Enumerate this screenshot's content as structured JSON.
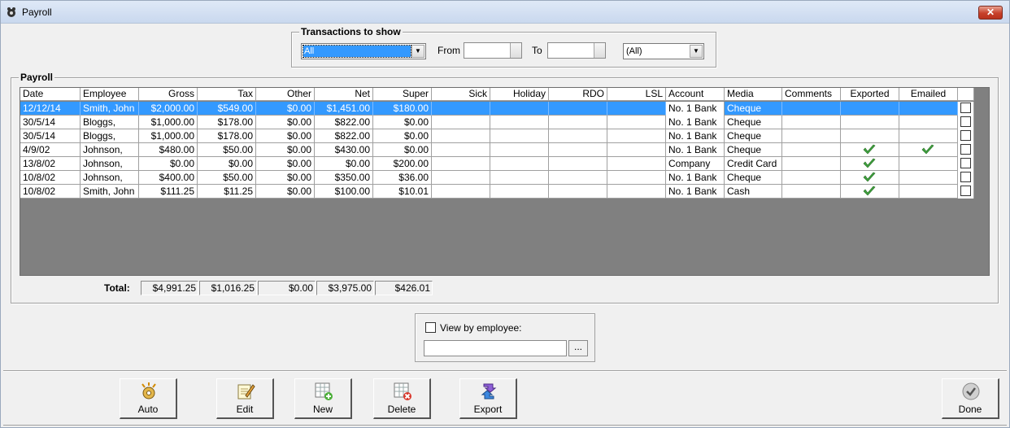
{
  "window": {
    "title": "Payroll",
    "close_glyph": "✕"
  },
  "filter": {
    "legend": "Transactions to show",
    "type_value": "All",
    "from_label": "From",
    "to_label": "To",
    "account_value": "(All)"
  },
  "payroll": {
    "legend": "Payroll",
    "columns": [
      "Date",
      "Employee",
      "Gross",
      "Tax",
      "Other",
      "Net",
      "Super",
      "Sick",
      "Holiday",
      "RDO",
      "LSL",
      "Account",
      "Media",
      "Comments",
      "Exported",
      "Emailed"
    ],
    "rows": [
      {
        "date": "12/12/14",
        "employee": "Smith, John",
        "gross": "$2,000.00",
        "tax": "$549.00",
        "other": "$0.00",
        "net": "$1,451.00",
        "super": "$180.00",
        "account": "No. 1 Bank",
        "media": "Cheque",
        "exported": false,
        "emailed": false,
        "selected": true
      },
      {
        "date": "30/5/14",
        "employee": "Bloggs,",
        "gross": "$1,000.00",
        "tax": "$178.00",
        "other": "$0.00",
        "net": "$822.00",
        "super": "$0.00",
        "account": "No. 1 Bank",
        "media": "Cheque",
        "exported": false,
        "emailed": false,
        "selected": false
      },
      {
        "date": "30/5/14",
        "employee": "Bloggs,",
        "gross": "$1,000.00",
        "tax": "$178.00",
        "other": "$0.00",
        "net": "$822.00",
        "super": "$0.00",
        "account": "No. 1 Bank",
        "media": "Cheque",
        "exported": false,
        "emailed": false,
        "selected": false
      },
      {
        "date": "4/9/02",
        "employee": "Johnson,",
        "gross": "$480.00",
        "tax": "$50.00",
        "other": "$0.00",
        "net": "$430.00",
        "super": "$0.00",
        "account": "No. 1 Bank",
        "media": "Cheque",
        "exported": true,
        "emailed": true,
        "selected": false
      },
      {
        "date": "13/8/02",
        "employee": "Johnson,",
        "gross": "$0.00",
        "tax": "$0.00",
        "other": "$0.00",
        "net": "$0.00",
        "super": "$200.00",
        "account": "Company",
        "media": "Credit Card",
        "exported": true,
        "emailed": false,
        "selected": false
      },
      {
        "date": "10/8/02",
        "employee": "Johnson,",
        "gross": "$400.00",
        "tax": "$50.00",
        "other": "$0.00",
        "net": "$350.00",
        "super": "$36.00",
        "account": "No. 1 Bank",
        "media": "Cheque",
        "exported": true,
        "emailed": false,
        "selected": false
      },
      {
        "date": "10/8/02",
        "employee": "Smith, John",
        "gross": "$111.25",
        "tax": "$11.25",
        "other": "$0.00",
        "net": "$100.00",
        "super": "$10.01",
        "account": "No. 1 Bank",
        "media": "Cash",
        "exported": true,
        "emailed": false,
        "selected": false
      }
    ],
    "total_label": "Total:",
    "totals": [
      "$4,991.25",
      "$1,016.25",
      "$0.00",
      "$3,975.00",
      "$426.01"
    ]
  },
  "view_by_employee": {
    "label": "View by employee:",
    "browse_label": "..."
  },
  "toolbar": {
    "auto": "Auto",
    "edit": "Edit",
    "new": "New",
    "delete": "Delete",
    "export": "Export",
    "done": "Done"
  },
  "colors": {
    "selection": "#3399ff",
    "grid_bg": "#808080",
    "tick": "#3fa33f"
  }
}
